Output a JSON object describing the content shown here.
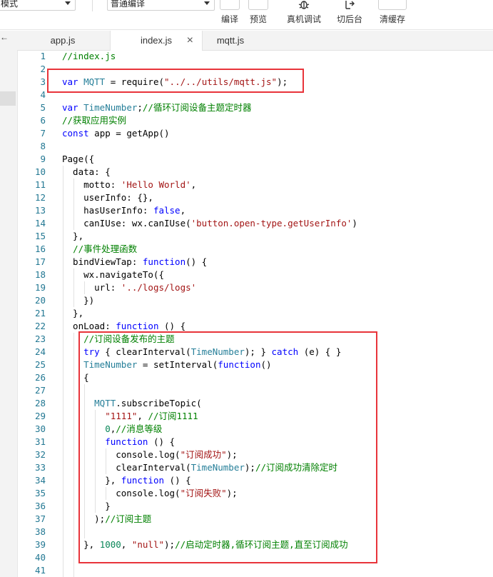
{
  "toolbar": {
    "mode_select": "模式",
    "compile_select": "普通编译",
    "buttons": [
      {
        "label": "编译",
        "icon": "refresh-icon"
      },
      {
        "label": "预览",
        "icon": "eye-icon"
      },
      {
        "label": "真机调试",
        "icon": "bug-icon"
      },
      {
        "label": "切后台",
        "icon": "background-switch-icon"
      },
      {
        "label": "清缓存",
        "icon": "layers-icon"
      }
    ]
  },
  "tabs": [
    {
      "label": "app.js",
      "active": false
    },
    {
      "label": "index.js",
      "active": true,
      "close": "×"
    },
    {
      "label": "mqtt.js",
      "active": false
    }
  ],
  "back_arrow": "←",
  "editor": {
    "line_numbers": [
      "1",
      "2",
      "3",
      "4",
      "5",
      "6",
      "7",
      "8",
      "9",
      "10",
      "11",
      "12",
      "13",
      "14",
      "15",
      "16",
      "17",
      "18",
      "19",
      "20",
      "21",
      "22",
      "23",
      "24",
      "25",
      "26",
      "27",
      "28",
      "29",
      "30",
      "31",
      "32",
      "33",
      "34",
      "35",
      "36",
      "37",
      "38",
      "39",
      "40",
      "41"
    ],
    "code_lines": [
      "//index.js",
      "",
      "var MQTT = require(\"../../utils/mqtt.js\");",
      "",
      "var TimeNumber;//循环订阅设备主题定时器",
      "//获取应用实例",
      "const app = getApp()",
      "",
      "Page({",
      "  data: {",
      "    motto: 'Hello World',",
      "    userInfo: {},",
      "    hasUserInfo: false,",
      "    canIUse: wx.canIUse('button.open-type.getUserInfo')",
      "  },",
      "  //事件处理函数",
      "  bindViewTap: function() {",
      "    wx.navigateTo({",
      "      url: '../logs/logs'",
      "    })",
      "  },",
      "  onLoad: function () {",
      "    //订阅设备发布的主题",
      "    try { clearInterval(TimeNumber); } catch (e) { }",
      "    TimeNumber = setInterval(function()",
      "    {",
      "",
      "      MQTT.subscribeTopic(",
      "        \"1111\", //订阅1111",
      "        0,//消息等级",
      "        function () {",
      "          console.log(\"订阅成功\");",
      "          clearInterval(TimeNumber);//订阅成功清除定时",
      "        }, function () {",
      "          console.log(\"订阅失败\");",
      "        }",
      "      );//订阅主题",
      "",
      "    }, 1000, \"null\");//启动定时器,循环订阅主题,直至订阅成功",
      "",
      ""
    ]
  },
  "colors": {
    "keyword": "#0000ff",
    "identifier": "#267f99",
    "string": "#a31515",
    "comment": "#008000",
    "number": "#098658",
    "line_number": "#237893",
    "highlight_box": "#e8343a"
  }
}
